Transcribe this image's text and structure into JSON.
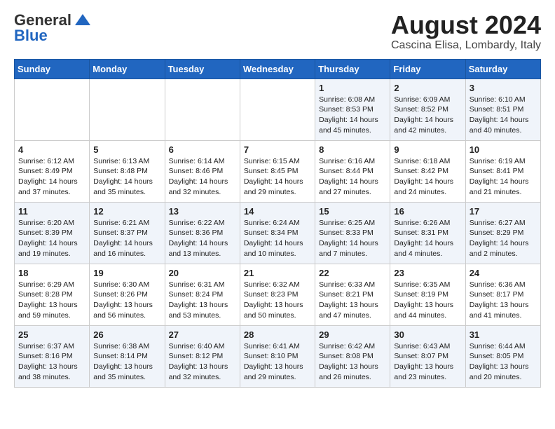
{
  "header": {
    "logo_line1": "General",
    "logo_line2": "Blue",
    "title": "August 2024",
    "subtitle": "Cascina Elisa, Lombardy, Italy"
  },
  "calendar": {
    "weekdays": [
      "Sunday",
      "Monday",
      "Tuesday",
      "Wednesday",
      "Thursday",
      "Friday",
      "Saturday"
    ],
    "weeks": [
      [
        {
          "day": "",
          "info": ""
        },
        {
          "day": "",
          "info": ""
        },
        {
          "day": "",
          "info": ""
        },
        {
          "day": "",
          "info": ""
        },
        {
          "day": "1",
          "info": "Sunrise: 6:08 AM\nSunset: 8:53 PM\nDaylight: 14 hours\nand 45 minutes."
        },
        {
          "day": "2",
          "info": "Sunrise: 6:09 AM\nSunset: 8:52 PM\nDaylight: 14 hours\nand 42 minutes."
        },
        {
          "day": "3",
          "info": "Sunrise: 6:10 AM\nSunset: 8:51 PM\nDaylight: 14 hours\nand 40 minutes."
        }
      ],
      [
        {
          "day": "4",
          "info": "Sunrise: 6:12 AM\nSunset: 8:49 PM\nDaylight: 14 hours\nand 37 minutes."
        },
        {
          "day": "5",
          "info": "Sunrise: 6:13 AM\nSunset: 8:48 PM\nDaylight: 14 hours\nand 35 minutes."
        },
        {
          "day": "6",
          "info": "Sunrise: 6:14 AM\nSunset: 8:46 PM\nDaylight: 14 hours\nand 32 minutes."
        },
        {
          "day": "7",
          "info": "Sunrise: 6:15 AM\nSunset: 8:45 PM\nDaylight: 14 hours\nand 29 minutes."
        },
        {
          "day": "8",
          "info": "Sunrise: 6:16 AM\nSunset: 8:44 PM\nDaylight: 14 hours\nand 27 minutes."
        },
        {
          "day": "9",
          "info": "Sunrise: 6:18 AM\nSunset: 8:42 PM\nDaylight: 14 hours\nand 24 minutes."
        },
        {
          "day": "10",
          "info": "Sunrise: 6:19 AM\nSunset: 8:41 PM\nDaylight: 14 hours\nand 21 minutes."
        }
      ],
      [
        {
          "day": "11",
          "info": "Sunrise: 6:20 AM\nSunset: 8:39 PM\nDaylight: 14 hours\nand 19 minutes."
        },
        {
          "day": "12",
          "info": "Sunrise: 6:21 AM\nSunset: 8:37 PM\nDaylight: 14 hours\nand 16 minutes."
        },
        {
          "day": "13",
          "info": "Sunrise: 6:22 AM\nSunset: 8:36 PM\nDaylight: 14 hours\nand 13 minutes."
        },
        {
          "day": "14",
          "info": "Sunrise: 6:24 AM\nSunset: 8:34 PM\nDaylight: 14 hours\nand 10 minutes."
        },
        {
          "day": "15",
          "info": "Sunrise: 6:25 AM\nSunset: 8:33 PM\nDaylight: 14 hours\nand 7 minutes."
        },
        {
          "day": "16",
          "info": "Sunrise: 6:26 AM\nSunset: 8:31 PM\nDaylight: 14 hours\nand 4 minutes."
        },
        {
          "day": "17",
          "info": "Sunrise: 6:27 AM\nSunset: 8:29 PM\nDaylight: 14 hours\nand 2 minutes."
        }
      ],
      [
        {
          "day": "18",
          "info": "Sunrise: 6:29 AM\nSunset: 8:28 PM\nDaylight: 13 hours\nand 59 minutes."
        },
        {
          "day": "19",
          "info": "Sunrise: 6:30 AM\nSunset: 8:26 PM\nDaylight: 13 hours\nand 56 minutes."
        },
        {
          "day": "20",
          "info": "Sunrise: 6:31 AM\nSunset: 8:24 PM\nDaylight: 13 hours\nand 53 minutes."
        },
        {
          "day": "21",
          "info": "Sunrise: 6:32 AM\nSunset: 8:23 PM\nDaylight: 13 hours\nand 50 minutes."
        },
        {
          "day": "22",
          "info": "Sunrise: 6:33 AM\nSunset: 8:21 PM\nDaylight: 13 hours\nand 47 minutes."
        },
        {
          "day": "23",
          "info": "Sunrise: 6:35 AM\nSunset: 8:19 PM\nDaylight: 13 hours\nand 44 minutes."
        },
        {
          "day": "24",
          "info": "Sunrise: 6:36 AM\nSunset: 8:17 PM\nDaylight: 13 hours\nand 41 minutes."
        }
      ],
      [
        {
          "day": "25",
          "info": "Sunrise: 6:37 AM\nSunset: 8:16 PM\nDaylight: 13 hours\nand 38 minutes."
        },
        {
          "day": "26",
          "info": "Sunrise: 6:38 AM\nSunset: 8:14 PM\nDaylight: 13 hours\nand 35 minutes."
        },
        {
          "day": "27",
          "info": "Sunrise: 6:40 AM\nSunset: 8:12 PM\nDaylight: 13 hours\nand 32 minutes."
        },
        {
          "day": "28",
          "info": "Sunrise: 6:41 AM\nSunset: 8:10 PM\nDaylight: 13 hours\nand 29 minutes."
        },
        {
          "day": "29",
          "info": "Sunrise: 6:42 AM\nSunset: 8:08 PM\nDaylight: 13 hours\nand 26 minutes."
        },
        {
          "day": "30",
          "info": "Sunrise: 6:43 AM\nSunset: 8:07 PM\nDaylight: 13 hours\nand 23 minutes."
        },
        {
          "day": "31",
          "info": "Sunrise: 6:44 AM\nSunset: 8:05 PM\nDaylight: 13 hours\nand 20 minutes."
        }
      ]
    ]
  }
}
